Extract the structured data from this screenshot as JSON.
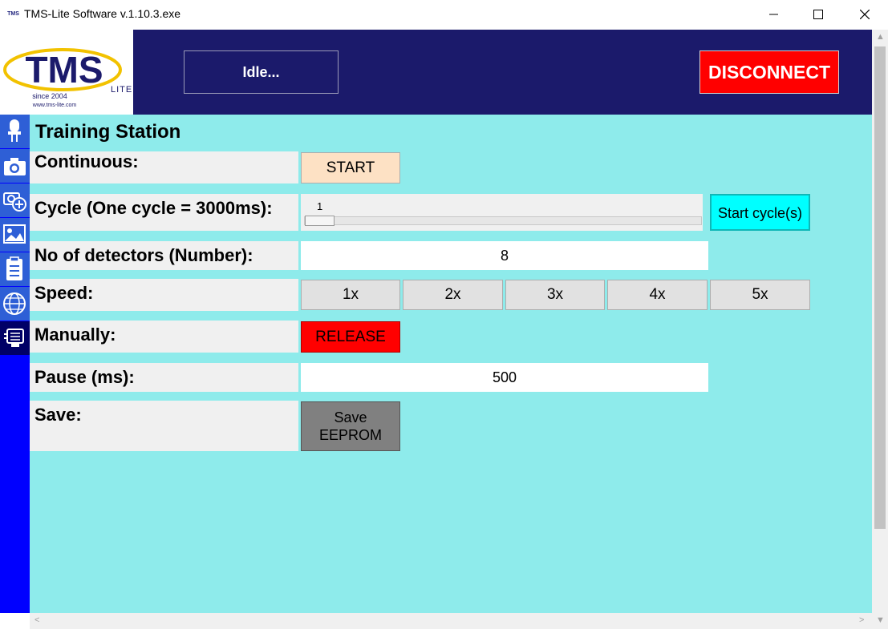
{
  "window": {
    "title": "TMS-Lite Software v.1.10.3.exe",
    "icon_text": "TMS"
  },
  "header": {
    "logo": {
      "brand": "TMS",
      "sub": "LITE",
      "since": "since 2004",
      "url": "www.tms-lite.com"
    },
    "status": "Idle...",
    "disconnect_label": "DISCONNECT"
  },
  "sidebar": {
    "items": [
      {
        "icon": "sensor-icon"
      },
      {
        "icon": "camera-icon"
      },
      {
        "icon": "add-camera-icon"
      },
      {
        "icon": "image-icon"
      },
      {
        "icon": "clipboard-checklist-icon"
      },
      {
        "icon": "globe-icon"
      },
      {
        "icon": "monitor-icon",
        "active": true
      }
    ]
  },
  "page": {
    "title": "Training Station",
    "continuous": {
      "label": "Continuous:",
      "button": "START"
    },
    "cycle": {
      "label": "Cycle (One cycle = 3000ms):",
      "slider_value": "1",
      "button": "Start cycle(s)"
    },
    "detectors": {
      "label": "No of detectors (Number):",
      "value": "8"
    },
    "speed": {
      "label": "Speed:",
      "options": [
        "1x",
        "2x",
        "3x",
        "4x",
        "5x"
      ]
    },
    "manually": {
      "label": "Manually:",
      "button": "RELEASE"
    },
    "pause": {
      "label": "Pause (ms):",
      "value": "500"
    },
    "save": {
      "label": "Save:",
      "button_line1": "Save",
      "button_line2": "EEPROM"
    }
  },
  "colors": {
    "header_bg": "#1b1a6b",
    "content_bg": "#8eebeb",
    "sidebar_bg": "#0000ff",
    "disconnect_bg": "#ff0000",
    "start_bg": "#fde1c4",
    "start_cycle_bg": "#00ffff",
    "release_bg": "#ff0000",
    "save_bg": "#808080"
  }
}
